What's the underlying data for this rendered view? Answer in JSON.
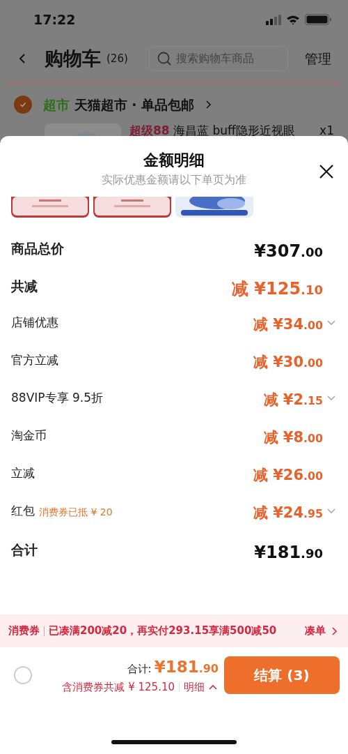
{
  "status_bar": {
    "time": "17:22"
  },
  "header": {
    "title": "购物车",
    "count": "(26)",
    "search": {
      "placeholder": "搜索购物车商品"
    },
    "manage": "管理"
  },
  "store": {
    "checked": true,
    "tag": "超市",
    "name": "天猫超市 · 单品包邮"
  },
  "product": {
    "badge": "超级88",
    "title": "海昌蓝 buff隐形近视眼",
    "qty": "x1"
  },
  "sheet": {
    "title": "金额明细",
    "subtitle": "实际优惠金额请以下单页为准",
    "rows": [
      {
        "kind": "total",
        "label": "商品总价",
        "amount_main": "¥307",
        "amount_cents": ".00",
        "expandable": false
      },
      {
        "kind": "discount_total",
        "label": "共减",
        "prefix": "减",
        "amount_main": "¥125",
        "amount_cents": ".10",
        "expandable": false
      },
      {
        "kind": "discount",
        "label": "店铺优惠",
        "prefix": "减",
        "amount_main": "¥34",
        "amount_cents": ".00",
        "expandable": true
      },
      {
        "kind": "discount",
        "label": "官方立减",
        "prefix": "减",
        "amount_main": "¥30",
        "amount_cents": ".00",
        "expandable": false
      },
      {
        "kind": "discount",
        "label": "88VIP专享 9.5折",
        "prefix": "减",
        "amount_main": "¥2",
        "amount_cents": ".15",
        "expandable": true
      },
      {
        "kind": "discount",
        "label": "淘金币",
        "prefix": "减",
        "amount_main": "¥8",
        "amount_cents": ".00",
        "expandable": false
      },
      {
        "kind": "discount",
        "label": "立减",
        "prefix": "减",
        "amount_main": "¥26",
        "amount_cents": ".00",
        "expandable": false
      },
      {
        "kind": "discount",
        "label": "红包",
        "note": "消费券已抵 ¥ 20",
        "prefix": "减",
        "amount_main": "¥24",
        "amount_cents": ".95",
        "expandable": true
      },
      {
        "kind": "total",
        "label": "合计",
        "amount_main": "¥181",
        "amount_cents": ".90",
        "expandable": false
      }
    ]
  },
  "coupon_banner": {
    "tag": "消费券",
    "text": "已凑满200减20，再实付293.15享满500减50",
    "action": "凑单"
  },
  "footer": {
    "select_all": {
      "checked": false
    },
    "total_label": "合计:",
    "total_main": "¥181",
    "total_cents": ".90",
    "saving": "含消费券共减 ¥ 125.10",
    "detail": "明细",
    "expanded": true,
    "checkout": "结算 (3)"
  }
}
